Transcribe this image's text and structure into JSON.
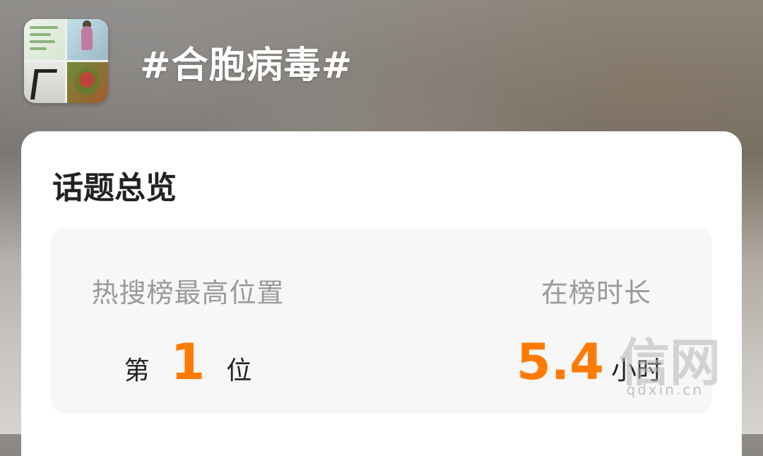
{
  "header": {
    "topic_title": "#合胞病毒#"
  },
  "overview": {
    "title": "话题总览",
    "hot_rank": {
      "label": "热搜榜最高位置",
      "prefix": "第",
      "value": "1",
      "suffix": "位"
    },
    "duration": {
      "label": "在榜时长",
      "value": "5.4",
      "unit": "小时"
    }
  },
  "watermark": {
    "brand": "信网",
    "site": "qdxin.cn"
  },
  "colors": {
    "accent": "#ff7a00",
    "label_gray": "#9a9a9a",
    "text_dark": "#222222"
  }
}
